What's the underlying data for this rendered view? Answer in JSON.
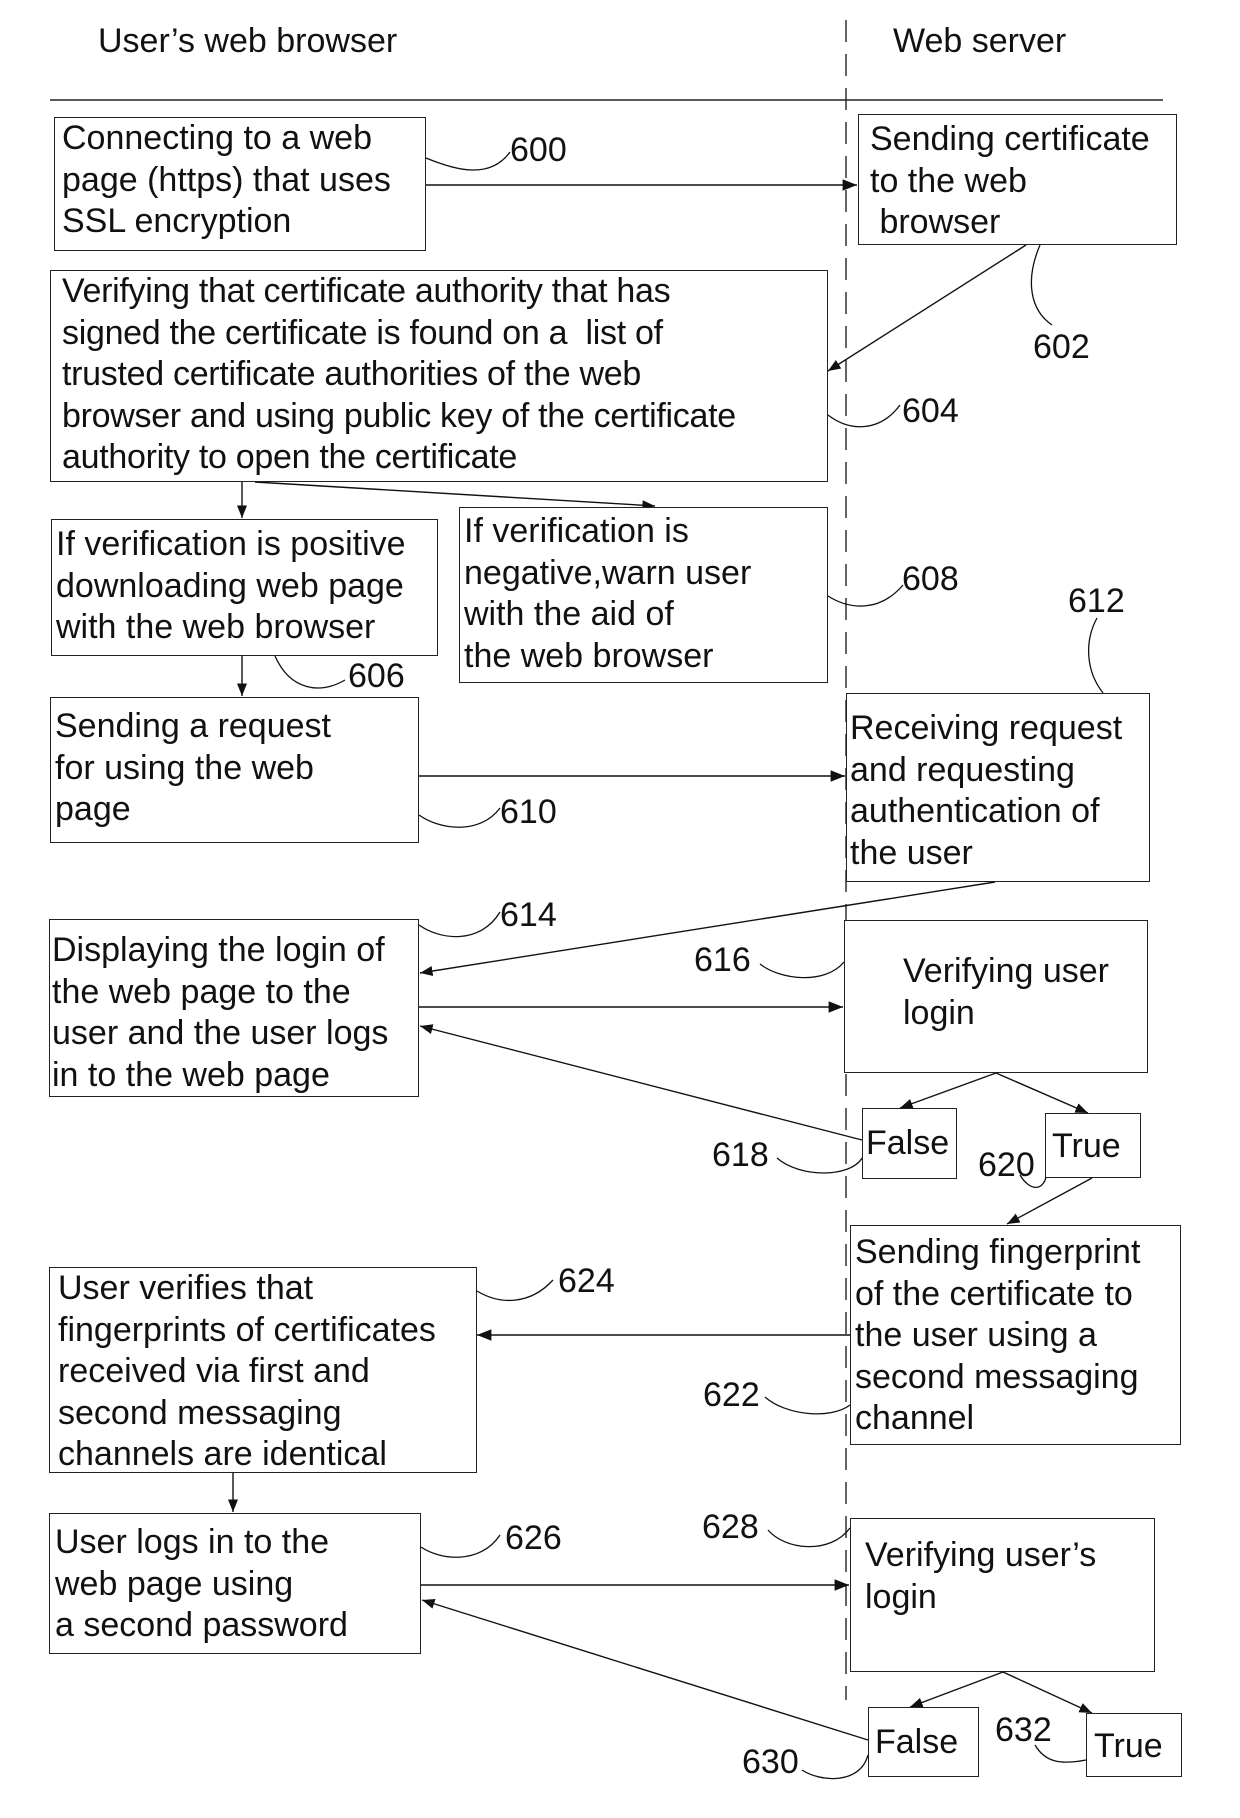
{
  "lanes": {
    "left": "User’s web browser",
    "right": "Web server"
  },
  "steps": {
    "s600": {
      "ref": "600",
      "lines": [
        "Connecting to a web",
        "page (https) that uses",
        "SSL encryption"
      ]
    },
    "s602": {
      "ref": "602",
      "lines": [
        "Sending certificate",
        "to the web",
        " browser"
      ]
    },
    "s604": {
      "ref": "604",
      "lines": [
        "Verifying that certificate authority that has",
        "signed the certificate is found on a  list of",
        "trusted certificate authorities of the web",
        "browser and using public key of the certificate",
        "authority to open the certificate"
      ]
    },
    "s606": {
      "ref": "606",
      "lines": [
        "If verification is positive",
        "downloading web page",
        "with the web browser"
      ]
    },
    "s608": {
      "ref": "608",
      "lines": [
        "If verification is",
        "negative,warn user",
        "with the aid of",
        "the web browser"
      ]
    },
    "s610": {
      "ref": "610",
      "lines": [
        "Sending a request",
        "for using the web",
        "page"
      ]
    },
    "s612": {
      "ref": "612",
      "lines": [
        "Receiving request",
        "and requesting",
        "authentication of",
        "the user"
      ]
    },
    "s614": {
      "ref": "614",
      "lines": [
        "Displaying the login of",
        "the web page to the",
        "user and the user logs",
        "in to the web page"
      ]
    },
    "s616": {
      "ref": "616",
      "lines": [
        "Verifying user",
        "login"
      ]
    },
    "s618": {
      "ref": "618",
      "label": "False"
    },
    "s620": {
      "ref": "620",
      "label": "True"
    },
    "s622": {
      "ref": "622",
      "lines": [
        "Sending fingerprint",
        "of the certificate to",
        "the user using a",
        "second messaging",
        "channel"
      ]
    },
    "s624": {
      "ref": "624",
      "lines": [
        "User verifies that",
        "fingerprints of certificates",
        "received via first and",
        "second messaging",
        "channels are identical"
      ]
    },
    "s626": {
      "ref": "626",
      "lines": [
        "User logs in to the",
        "web page using",
        "a second password"
      ]
    },
    "s628": {
      "ref": "628",
      "lines": [
        "Verifying user’s",
        "login"
      ]
    },
    "s630": {
      "ref": "630",
      "label": "False"
    },
    "s632": {
      "ref": "632",
      "label": "True"
    }
  }
}
